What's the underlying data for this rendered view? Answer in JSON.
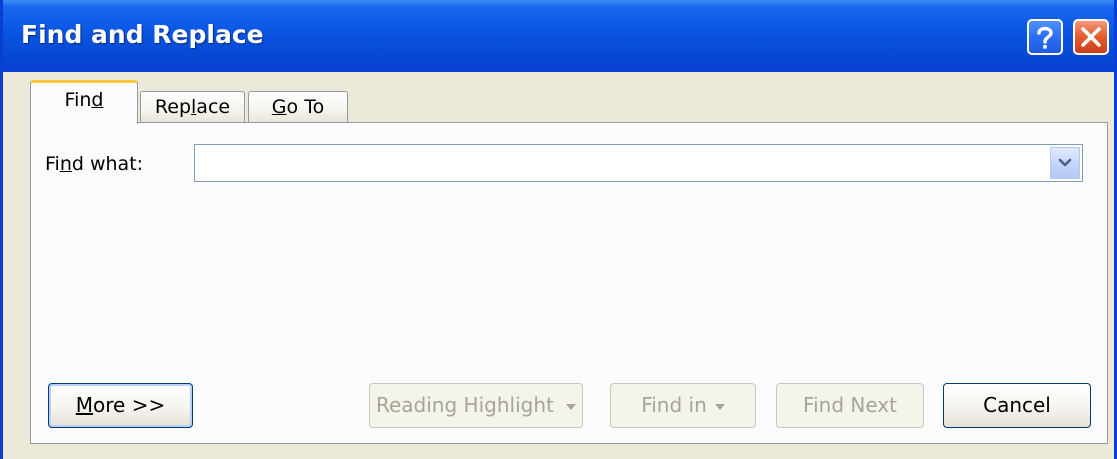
{
  "window": {
    "title": "Find and Replace",
    "help_icon": "question-mark-icon",
    "close_icon": "close-x-icon"
  },
  "tabs": [
    {
      "label_pre": "Fin",
      "label_key": "d",
      "label_post": "",
      "active": true
    },
    {
      "label_pre": "Rep",
      "label_key": "l",
      "label_post": "ace",
      "active": false
    },
    {
      "label_pre": "",
      "label_key": "G",
      "label_post": "o To",
      "active": false
    }
  ],
  "find": {
    "label_pre": "Fi",
    "label_key": "n",
    "label_post": "d what:",
    "value": "",
    "dropdown_icon": "chevron-down-icon"
  },
  "buttons": {
    "more_key": "M",
    "more_post": "ore >>",
    "reading_highlight": "Reading Highlight",
    "find_in": "Find in",
    "find_next": "Find Next",
    "cancel": "Cancel"
  },
  "colors": {
    "titlebar": "#0a55e2",
    "dialog_bg": "#ece9d8",
    "active_tab_accent": "#ffc83c",
    "close_button": "#e35b2e"
  }
}
